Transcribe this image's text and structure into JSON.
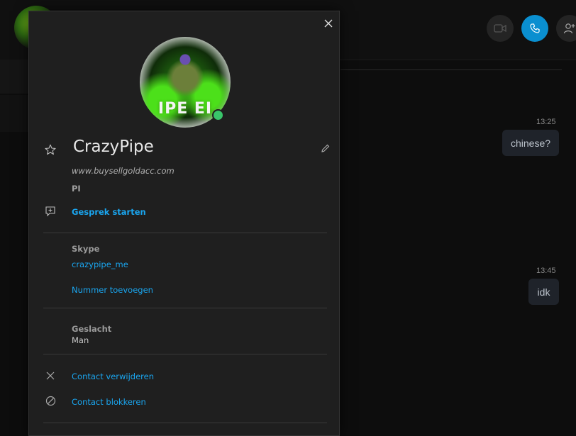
{
  "chat": {
    "messages": [
      {
        "time": "13:25",
        "text": "chinese?"
      },
      {
        "time": "13:45",
        "text": "idk"
      }
    ]
  },
  "profile": {
    "name": "CrazyPipe",
    "mood": "www.buysellgoldacc.com",
    "location": "PI",
    "start_chat_label": "Gesprek starten",
    "avatar_banner": "IPE EI",
    "status_color": "#39c56a"
  },
  "skype": {
    "label": "Skype",
    "username": "crazypipe_me",
    "add_number_label": "Nummer toevoegen"
  },
  "gender": {
    "label": "Geslacht",
    "value": "Man"
  },
  "actions": {
    "remove_contact_label": "Contact verwijderen",
    "block_contact_label": "Contact blokkeren"
  },
  "colors": {
    "accent": "#1aa6f0",
    "call_button": "#0a8fd0",
    "panel_bg": "#1f1f1f"
  }
}
